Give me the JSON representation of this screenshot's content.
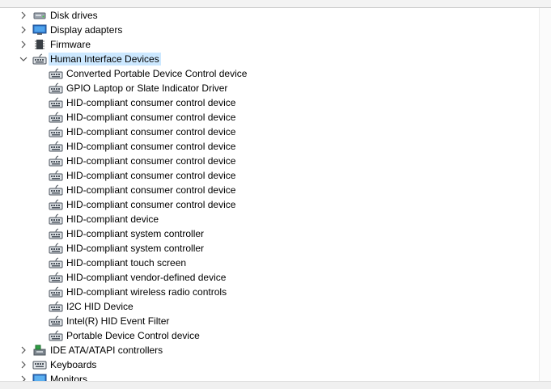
{
  "tree": {
    "categories_before": [
      {
        "label": "Disk drives",
        "icon": "disk-drive-icon",
        "expanded": false
      },
      {
        "label": "Display adapters",
        "icon": "display-adapter-icon",
        "expanded": false
      },
      {
        "label": "Firmware",
        "icon": "firmware-chip-icon",
        "expanded": false
      }
    ],
    "hid_category": {
      "label": "Human Interface Devices",
      "icon": "hid-device-icon",
      "expanded": true,
      "selected": true
    },
    "hid_children": [
      "Converted Portable Device Control device",
      "GPIO Laptop or Slate Indicator Driver",
      "HID-compliant consumer control device",
      "HID-compliant consumer control device",
      "HID-compliant consumer control device",
      "HID-compliant consumer control device",
      "HID-compliant consumer control device",
      "HID-compliant consumer control device",
      "HID-compliant consumer control device",
      "HID-compliant consumer control device",
      "HID-compliant device",
      "HID-compliant system controller",
      "HID-compliant system controller",
      "HID-compliant touch screen",
      "HID-compliant vendor-defined device",
      "HID-compliant wireless radio controls",
      "I2C HID Device",
      "Intel(R) HID Event Filter",
      "Portable Device Control device"
    ],
    "categories_after": [
      {
        "label": "IDE ATA/ATAPI controllers",
        "icon": "ide-controller-icon",
        "expanded": false
      },
      {
        "label": "Keyboards",
        "icon": "keyboard-icon",
        "expanded": false
      },
      {
        "label": "Monitors",
        "icon": "monitor-icon",
        "expanded": false
      }
    ]
  },
  "colors": {
    "selection": "#cce8ff"
  }
}
